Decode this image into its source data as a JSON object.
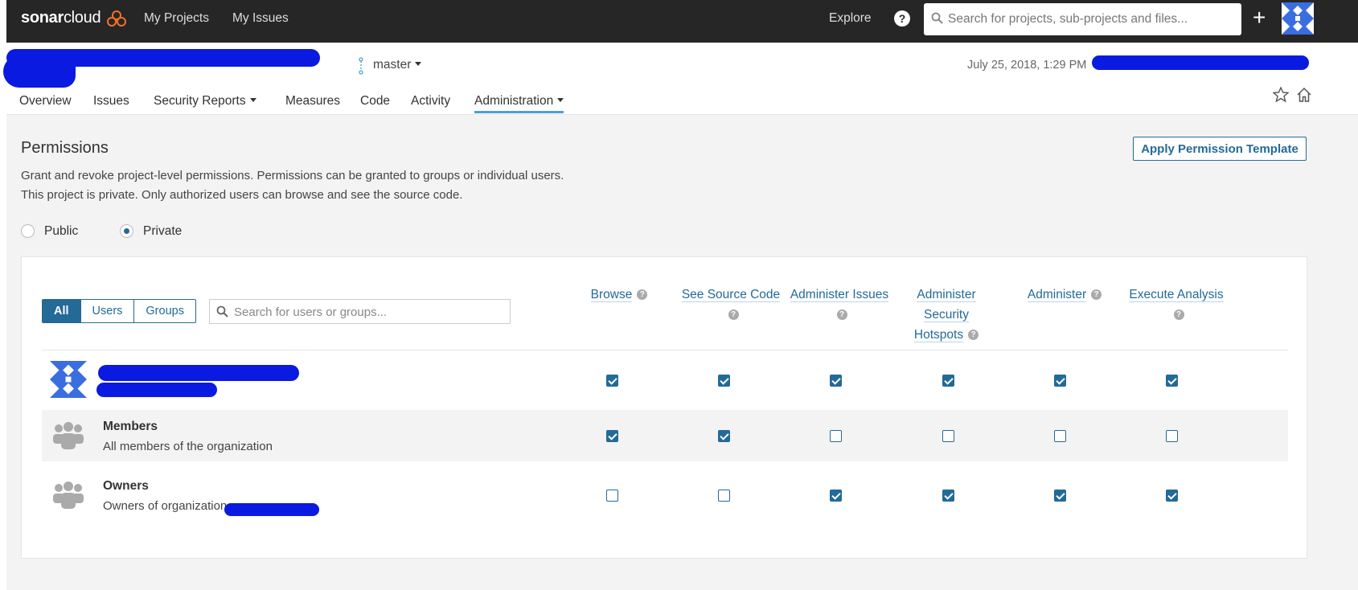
{
  "topbar": {
    "logo_sonar": "sonar",
    "logo_cloud": "cloud",
    "nav": [
      "My Projects",
      "My Issues"
    ],
    "explore": "Explore",
    "search_placeholder": "Search for projects, sub-projects and files..."
  },
  "project": {
    "branch": "master",
    "analysis_date": "July 25, 2018, 1:29 PM",
    "tabs": [
      {
        "label": "Overview",
        "dropdown": false,
        "active": false
      },
      {
        "label": "Issues",
        "dropdown": false,
        "active": false
      },
      {
        "label": "Security Reports",
        "dropdown": true,
        "active": false
      },
      {
        "label": "Measures",
        "dropdown": false,
        "active": false
      },
      {
        "label": "Code",
        "dropdown": false,
        "active": false
      },
      {
        "label": "Activity",
        "dropdown": false,
        "active": false
      },
      {
        "label": "Administration",
        "dropdown": true,
        "active": true
      }
    ]
  },
  "permissions": {
    "title": "Permissions",
    "apply_template_label": "Apply Permission Template",
    "description_1": "Grant and revoke project-level permissions. Permissions can be granted to groups or individual users.",
    "description_2": "This project is private. Only authorized users can browse and see the source code.",
    "visibility": {
      "public_label": "Public",
      "private_label": "Private",
      "selected": "Private"
    },
    "filters": {
      "all": "All",
      "users": "Users",
      "groups": "Groups",
      "active": "All"
    },
    "search_placeholder": "Search for users or groups...",
    "columns": [
      "Browse",
      "See Source Code",
      "Administer Issues",
      "Administer Security Hotspots",
      "Administer",
      "Execute Analysis"
    ],
    "rows": [
      {
        "name": "",
        "description": "",
        "type": "user",
        "permissions": [
          true,
          true,
          true,
          true,
          true,
          true
        ]
      },
      {
        "name": "Members",
        "description": "All members of the organization",
        "type": "group",
        "permissions": [
          true,
          true,
          false,
          false,
          false,
          false
        ]
      },
      {
        "name": "Owners",
        "description": "Owners of organization",
        "type": "group",
        "permissions": [
          false,
          false,
          true,
          true,
          true,
          true
        ]
      }
    ]
  },
  "colors": {
    "topbar_bg": "#262626",
    "accent": "#236a97",
    "tab_underline": "#4b9fd5",
    "redaction": "#0a1ae0"
  }
}
